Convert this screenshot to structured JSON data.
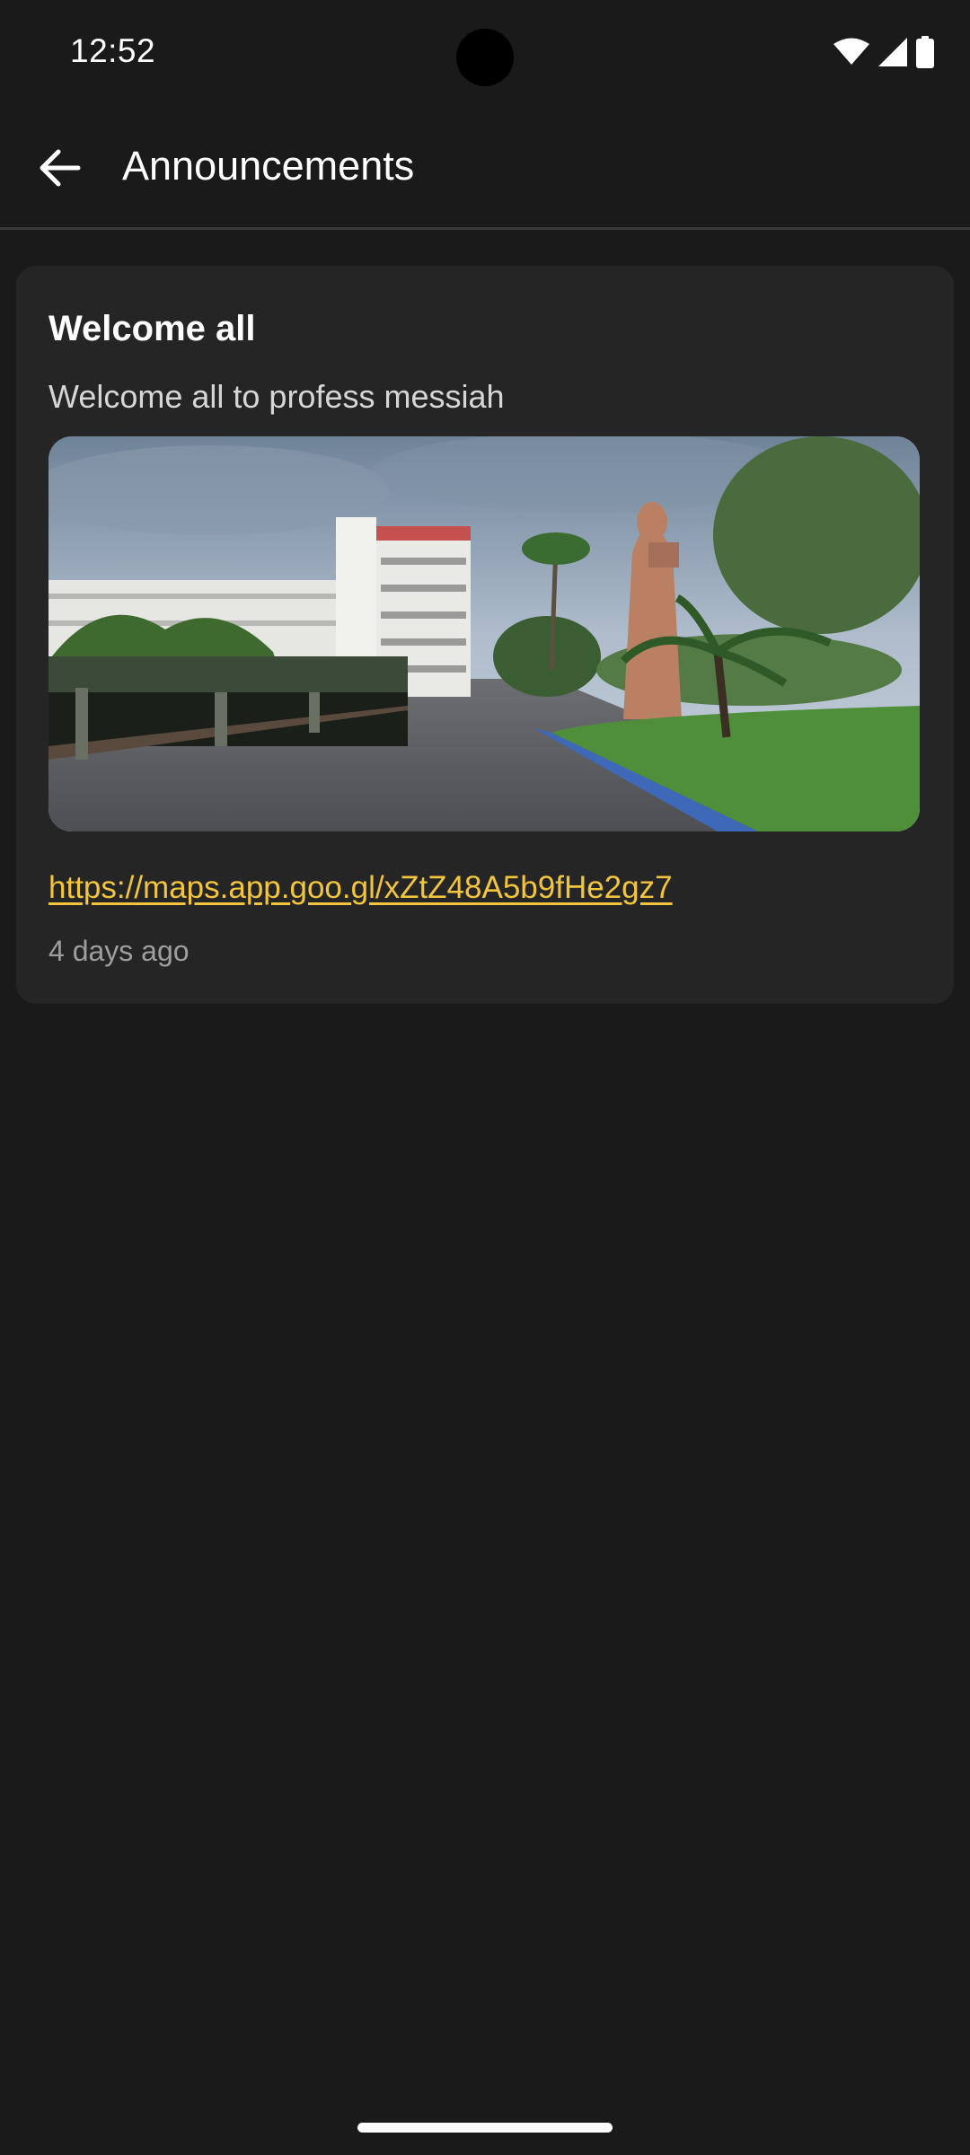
{
  "status_bar": {
    "time": "12:52",
    "icons": [
      "wifi-icon",
      "cellular-signal-icon",
      "battery-icon"
    ]
  },
  "app_bar": {
    "back_icon": "arrow-left-icon",
    "title": "Announcements"
  },
  "announcements": [
    {
      "title": "Welcome all",
      "body": "Welcome all to profess messiah",
      "image": "campus-photo",
      "link": "https://maps.app.goo.gl/xZtZ48A5b9fHe2gz7",
      "time_ago": "4 days ago"
    }
  ],
  "colors": {
    "background": "#1a1a1a",
    "card": "#252525",
    "link": "#f2c53d",
    "muted_text": "#9e9e9e"
  }
}
